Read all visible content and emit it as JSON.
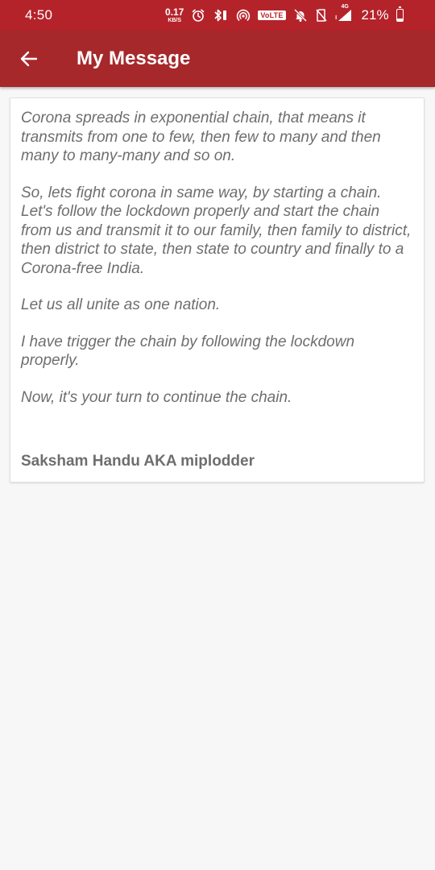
{
  "status_bar": {
    "time": "4:50",
    "net_speed_value": "0.17",
    "net_speed_unit": "KB/S",
    "volte_label": "VoLTE",
    "network_label": "4G",
    "battery_percent": "21%",
    "battery_level": 0.21
  },
  "header": {
    "title": "My Message"
  },
  "message": {
    "paragraphs": [
      "Corona spreads in exponential chain, that means it transmits from one to few, then few to many and then many to many-many and so on.",
      "So, lets fight corona in same way, by starting a chain. Let's follow the lockdown properly and start the chain from us and transmit it to our family, then family to district, then district to state, then state to country and finally to a Corona-free India.",
      "Let us all unite as one nation.",
      "I have trigger the chain by following the lockdown properly.",
      "Now, it's your turn to continue the chain."
    ],
    "signature": "Saksham Handu AKA miplodder"
  },
  "colors": {
    "status_bar_bg": "#b5232a",
    "app_bar_bg": "#a6282b",
    "page_bg": "#f7f7f7",
    "message_text": "#6e6e6e"
  },
  "icons": {
    "back": "arrow-back-icon",
    "alarm": "alarm-icon",
    "bluetooth": "bluetooth-icon",
    "hotspot": "hotspot-icon",
    "mute": "bell-off-icon",
    "no_sim": "no-sim-icon",
    "signal": "signal-icon",
    "battery": "battery-icon"
  }
}
